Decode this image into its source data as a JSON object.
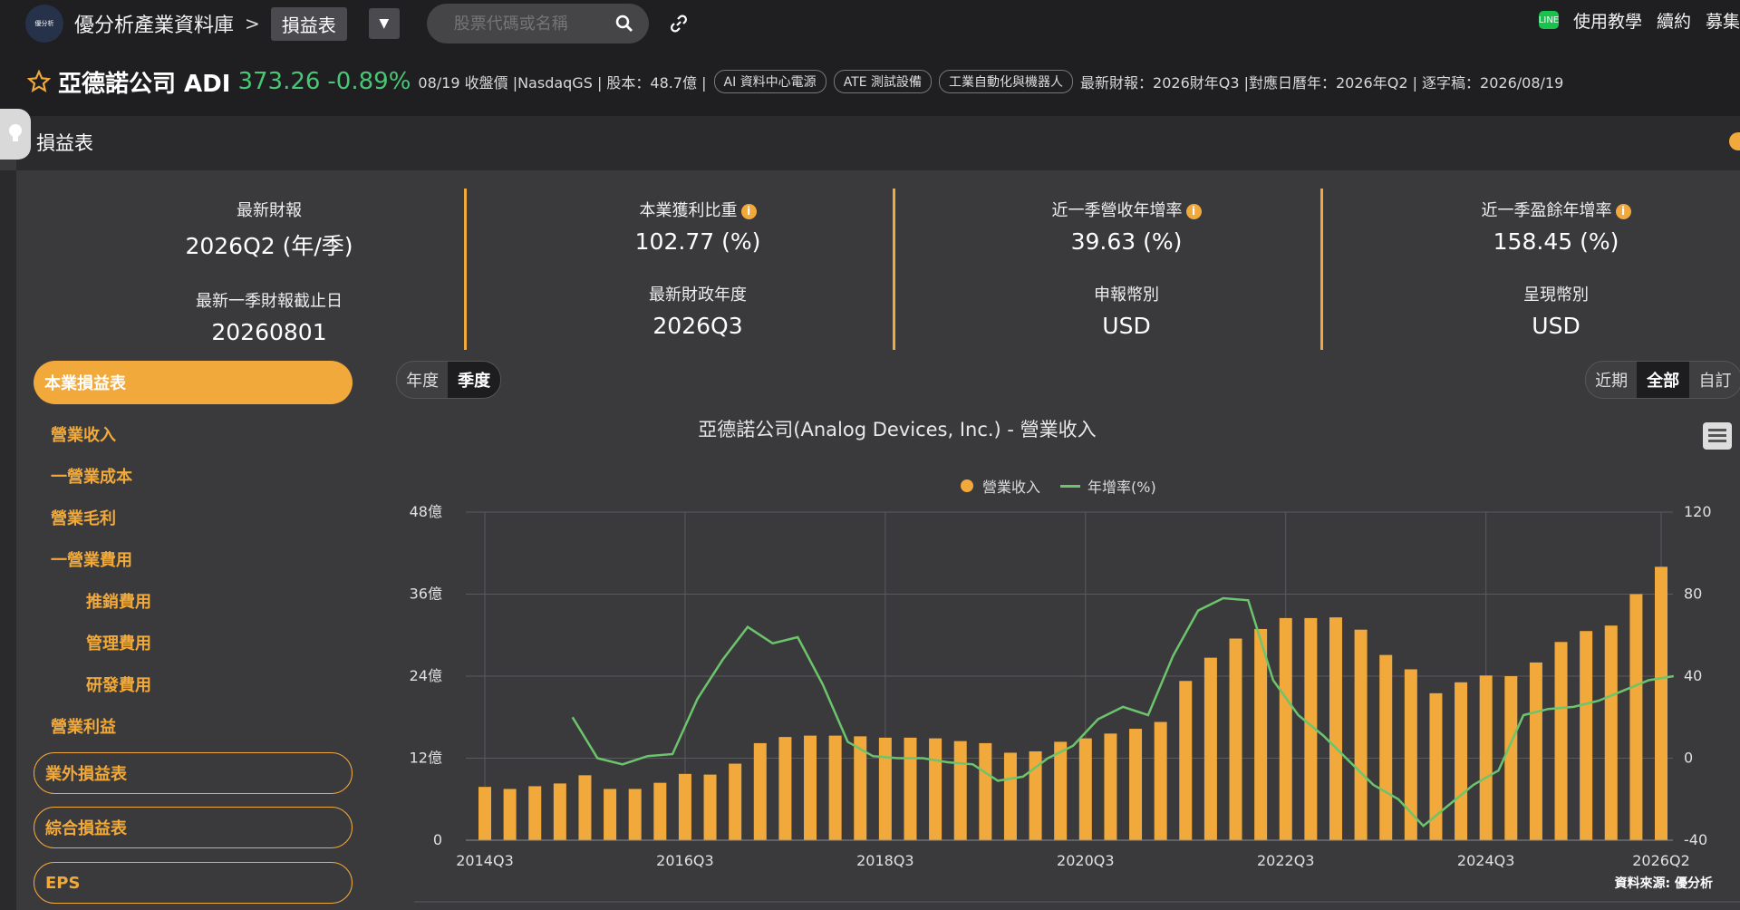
{
  "topbar": {
    "logo_text": "優分析",
    "brand": "優分析產業資料庫",
    "sep": ">",
    "crumb": "損益表",
    "search_placeholder": "股票代碼或名稱",
    "right_items": [
      "使用教學",
      "續約",
      "募集"
    ]
  },
  "stock": {
    "name": "亞德諾公司 ADI",
    "price": "373.26",
    "change": "-0.89%",
    "meta1": "08/19 收盤價 |NasdaqGS | 股本：48.7億 |",
    "tags": [
      "AI 資料中心電源",
      "ATE 測試設備",
      "工業自動化與機器人"
    ],
    "meta2": "最新財報：2026財年Q3 |對應日曆年：2026年Q2 | 逐字稿：2026/08/19"
  },
  "section": {
    "title": "損益表"
  },
  "stats": [
    {
      "label": "最新財報",
      "value": "2026Q2 (年/季)",
      "label2": "最新一季財報截止日",
      "value2": "20260801",
      "info": false
    },
    {
      "label": "本業獲利比重",
      "value": "102.77 (%)",
      "label2": "最新財政年度",
      "value2": "2026Q3",
      "info": true
    },
    {
      "label": "近一季營收年增率",
      "value": "39.63 (%)",
      "label2": "申報幣別",
      "value2": "USD",
      "info": true
    },
    {
      "label": "近一季盈餘年增率",
      "value": "158.45 (%)",
      "label2": "呈現幣別",
      "value2": "USD",
      "info": true
    }
  ],
  "menu": {
    "active": "本業損益表",
    "items": [
      "營業收入",
      "一營業成本",
      "營業毛利",
      "一營業費用",
      "推銷費用",
      "管理費用",
      "研發費用",
      "營業利益"
    ],
    "outlined": [
      "業外損益表",
      "綜合損益表",
      "EPS"
    ]
  },
  "period_toggle": [
    "年度",
    "季度"
  ],
  "range_toggle": [
    "近期",
    "全部",
    "自訂"
  ],
  "chart_data": {
    "type": "bar",
    "title": "亞德諾公司(Analog Devices, Inc.) - 營業收入",
    "series": [
      {
        "name": "營業收入",
        "type": "bar",
        "axis": "left",
        "color": "#f0a93a",
        "values": [
          7.8,
          7.5,
          7.9,
          8.3,
          9.5,
          7.5,
          7.5,
          8.4,
          9.7,
          9.6,
          11.2,
          14.2,
          15.1,
          15.3,
          15.3,
          15.2,
          15.0,
          15.0,
          14.9,
          14.5,
          14.2,
          12.8,
          13.0,
          14.4,
          14.9,
          15.6,
          16.3,
          17.3,
          23.3,
          26.7,
          29.5,
          30.9,
          32.5,
          32.5,
          32.6,
          30.8,
          27.1,
          25.0,
          21.5,
          23.1,
          24.1,
          24.0,
          26.0,
          29.0,
          30.6,
          31.4,
          36.0,
          40.0
        ]
      },
      {
        "name": "年增率(%)",
        "type": "line",
        "axis": "right",
        "color": "#6cc46c",
        "values": [
          null,
          null,
          null,
          null,
          20,
          0,
          -3,
          1,
          2,
          29,
          48,
          64,
          56,
          59,
          36,
          8,
          1,
          0,
          0,
          -2,
          -3,
          -11,
          -9,
          0,
          6,
          19,
          25,
          21,
          50,
          72,
          78,
          77,
          38,
          21,
          11,
          -1,
          -13,
          -20,
          -33,
          -23,
          -13,
          -6,
          21,
          24,
          25,
          28,
          33,
          38,
          40
        ]
      }
    ],
    "xlabels": [
      "2014Q3",
      "2016Q3",
      "2018Q3",
      "2020Q3",
      "2022Q3",
      "2024Q3",
      "2026Q2"
    ],
    "y_left": {
      "ticks": [
        "0",
        "12億",
        "24億",
        "36億",
        "48億"
      ],
      "range": [
        0,
        48
      ]
    },
    "y_right": {
      "ticks": [
        "-40",
        "0",
        "40",
        "80",
        "120"
      ],
      "range": [
        -40,
        120
      ]
    },
    "legend": [
      "營業收入",
      "年增率(%)"
    ]
  },
  "source": "資料來源: 優分析"
}
